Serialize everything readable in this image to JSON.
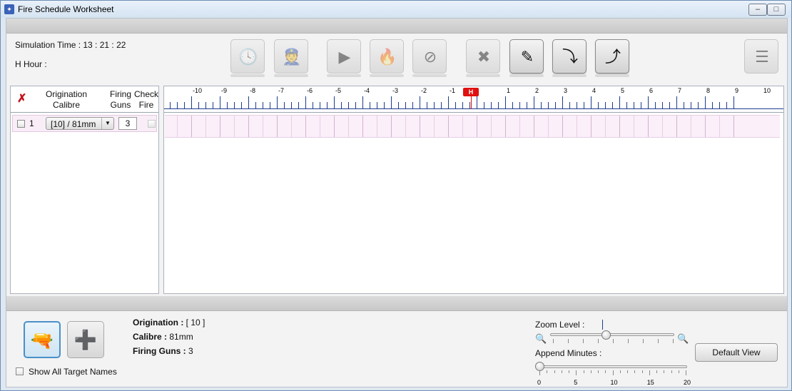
{
  "window": {
    "title": "Fire Schedule Worksheet"
  },
  "header": {
    "simulation_time": "Simulation Time : 13 : 21 : 22",
    "h_hour": "H Hour :"
  },
  "toolbar": {
    "buttons": [
      {
        "name": "set-h-hour-button",
        "icon": "clock-icon",
        "glyph": "🕓",
        "active": false
      },
      {
        "name": "assign-unit-button",
        "icon": "soldier-download-icon",
        "glyph": "👮",
        "active": false
      },
      {
        "name": "play-fire-button",
        "icon": "play-gun-icon",
        "glyph": "▶",
        "active": false
      },
      {
        "name": "fire-button",
        "icon": "fire-icon",
        "glyph": "🔥",
        "active": false
      },
      {
        "name": "cease-fire-button",
        "icon": "no-fire-icon",
        "glyph": "⊘",
        "active": false
      },
      {
        "name": "remove-gun-button",
        "icon": "cannon-x-icon",
        "glyph": "✖",
        "active": false
      },
      {
        "name": "edit-erase-button",
        "icon": "eraser-icon",
        "glyph": "✎",
        "active": true
      },
      {
        "name": "export-xml-button",
        "icon": "xml-export-icon",
        "glyph": "⤵",
        "active": true
      },
      {
        "name": "import-xml-button",
        "icon": "xml-import-icon",
        "glyph": "⤴",
        "active": true
      },
      {
        "name": "layout-button",
        "icon": "layout-icon",
        "glyph": "☰",
        "active": false
      }
    ]
  },
  "table": {
    "headers": {
      "origination": "Origination",
      "calibre": "Calibre",
      "firing": "Firing",
      "guns": "Guns",
      "check": "Check",
      "fire": "Fire"
    },
    "rows": [
      {
        "index": "1",
        "calibre": "[10] / 81mm",
        "guns": "3"
      }
    ]
  },
  "timeline": {
    "labels": [
      "-10",
      "-9",
      "-8",
      "-7",
      "-6",
      "-5",
      "-4",
      "-3",
      "-2",
      "-1",
      "1",
      "2",
      "3",
      "4",
      "5",
      "6",
      "7",
      "8",
      "9",
      "10"
    ],
    "h_label": "H"
  },
  "details": {
    "origination_label": "Origination :",
    "origination_value": "[ 10 ]",
    "calibre_label": "Calibre :",
    "calibre_value": "81mm",
    "guns_label": "Firing Guns :",
    "guns_value": "3"
  },
  "controls": {
    "show_names": "Show All Target Names",
    "zoom_label": "Zoom Level :",
    "append_label": "Append Minutes :",
    "append_ticks": [
      "0",
      "5",
      "10",
      "15",
      "20"
    ],
    "default_view": "Default View",
    "zoom_level": 0.45,
    "append_minutes": 0
  }
}
